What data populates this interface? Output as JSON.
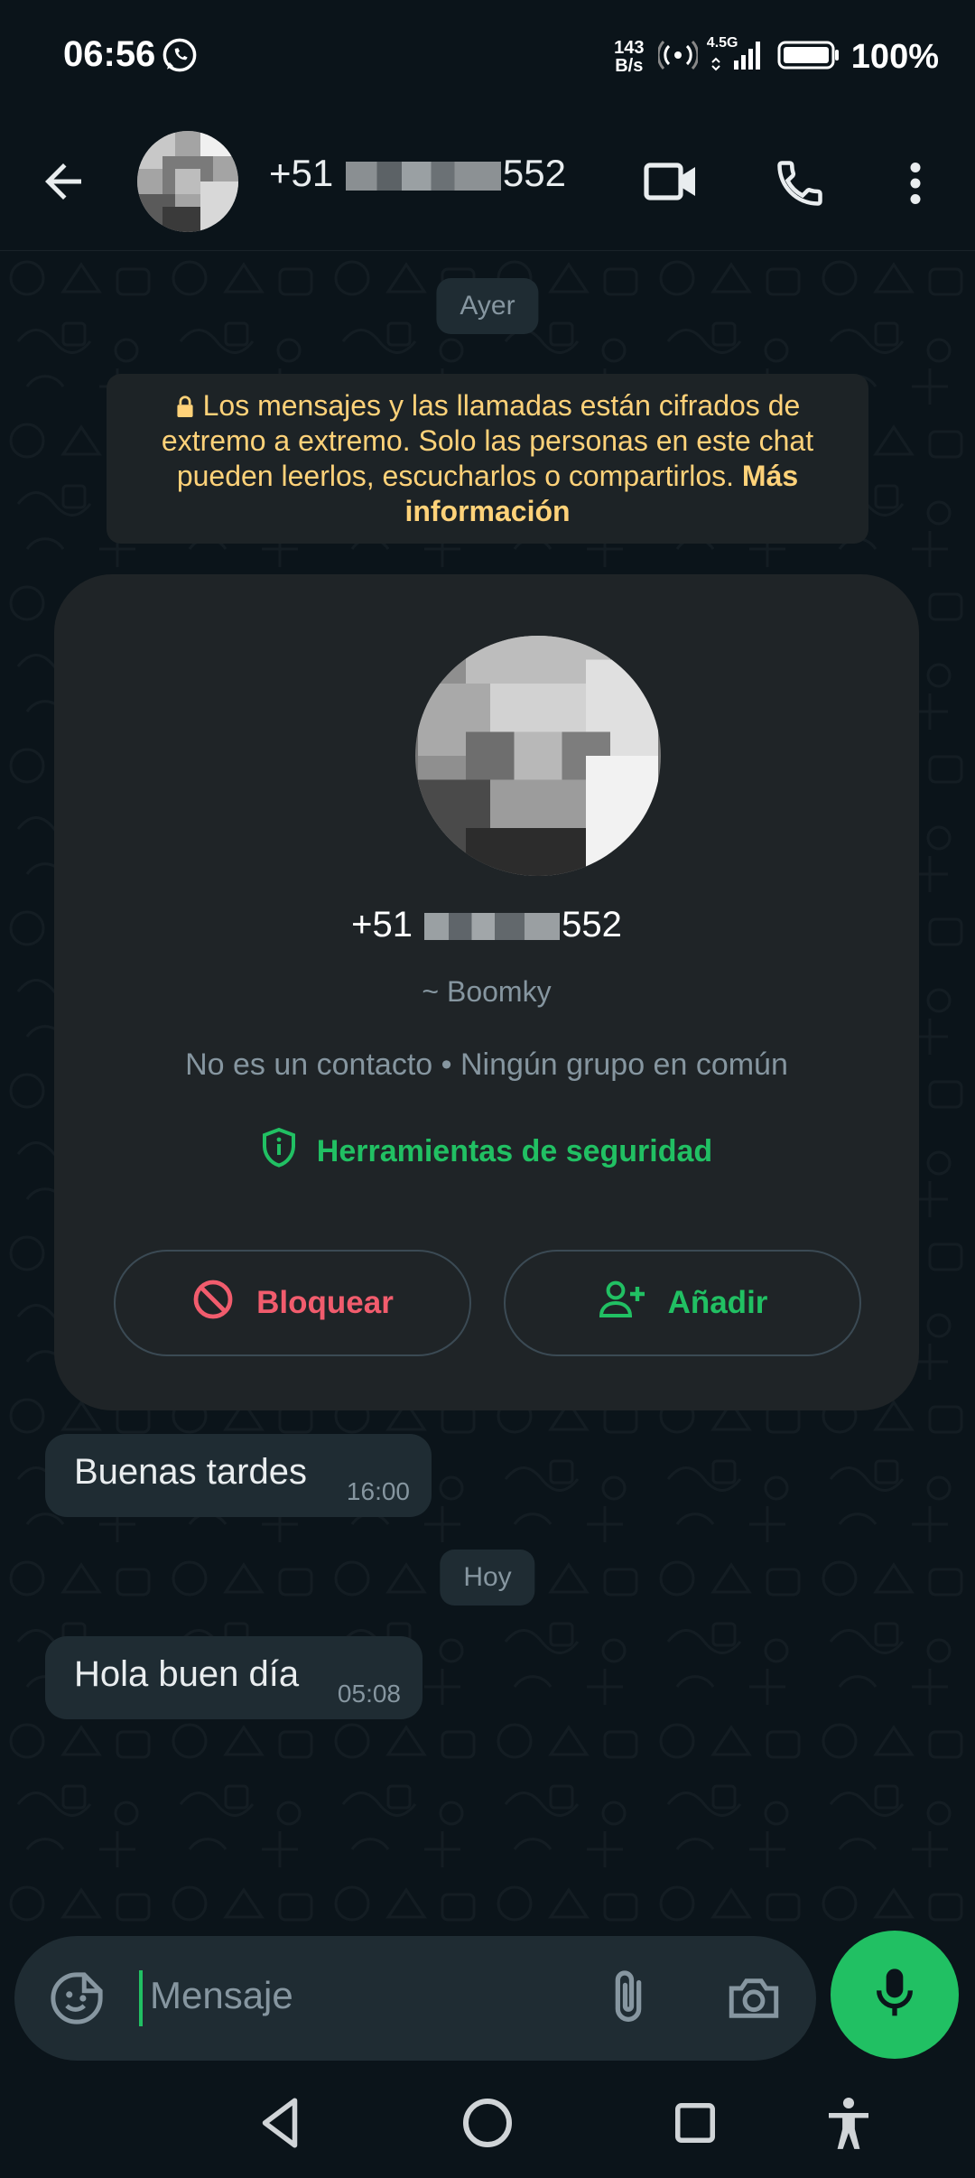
{
  "status_bar": {
    "time": "06:56",
    "net_speed_value": "143",
    "net_speed_unit": "B/s",
    "network": "4.5G",
    "battery": "100%"
  },
  "header": {
    "title_prefix": "+51",
    "title_suffix": "552"
  },
  "chat": {
    "date_yesterday": "Ayer",
    "encryption_notice": "Los mensajes y las llamadas están cifrados de extremo a extremo. Solo las personas en este chat pueden leerlos, escucharlos o compartirlos.",
    "encryption_link": "Más información",
    "contact_card": {
      "phone_prefix": "+51",
      "phone_suffix": "552",
      "name": "~ Boomky",
      "info": "No es un contacto • Ningún grupo en común",
      "security_tools": "Herramientas de seguridad",
      "block_label": "Bloquear",
      "add_label": "Añadir"
    },
    "messages": [
      {
        "text": "Buenas tardes",
        "time": "16:00"
      },
      {
        "text": "Hola buen día",
        "time": "05:08"
      }
    ],
    "date_today": "Hoy"
  },
  "composer": {
    "placeholder": "Mensaje"
  },
  "colors": {
    "accent": "#21c063",
    "danger": "#f15c6d",
    "notice": "#ffd279",
    "bubble": "#1f2c33",
    "background": "#0b141a"
  },
  "icons": [
    "whatsapp-icon",
    "back-arrow-icon",
    "video-call-icon",
    "phone-call-icon",
    "more-options-icon",
    "lock-icon",
    "shield-icon",
    "block-icon",
    "add-person-icon",
    "sticker-icon",
    "attach-icon",
    "camera-icon",
    "microphone-icon",
    "nav-back-icon",
    "nav-home-icon",
    "nav-recents-icon",
    "accessibility-icon"
  ]
}
